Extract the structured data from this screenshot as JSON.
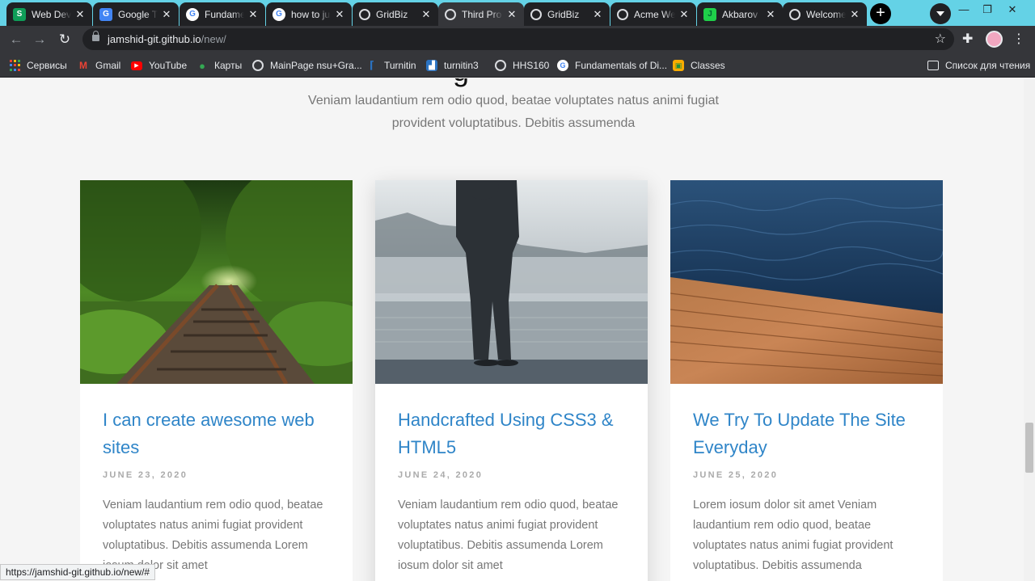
{
  "tabs": [
    {
      "title": "Web Dev",
      "favicon": "sheets-icon"
    },
    {
      "title": "Google Tr",
      "favicon": "translate-icon"
    },
    {
      "title": "Fundame",
      "favicon": "google-icon"
    },
    {
      "title": "how to ju",
      "favicon": "google-icon"
    },
    {
      "title": "GridBiz",
      "favicon": "globe-icon"
    },
    {
      "title": "Third Pro",
      "favicon": "globe-icon"
    },
    {
      "title": "GridBiz",
      "favicon": "globe-icon"
    },
    {
      "title": "Acme We",
      "favicon": "globe-icon"
    },
    {
      "title": "Akbarov",
      "favicon": "j-icon"
    },
    {
      "title": "Welcome",
      "favicon": "globe-icon"
    }
  ],
  "address": {
    "host": "jamshid-git.github.io",
    "path": "/new/"
  },
  "bookmarks": [
    {
      "label": "Сервисы"
    },
    {
      "label": "Gmail"
    },
    {
      "label": "YouTube"
    },
    {
      "label": "Карты"
    },
    {
      "label": "MainPage nsu+Gra..."
    },
    {
      "label": "Turnitin"
    },
    {
      "label": "turnitin3"
    },
    {
      "label": "HHS160"
    },
    {
      "label": "Fundamentals of Di..."
    },
    {
      "label": "Classes"
    }
  ],
  "reading_list": "Список для чтения",
  "page": {
    "heading_fragment": "g",
    "intro": "Veniam laudantium rem odio quod, beatae voluptates natus animi fugiat provident voluptatibus. Debitis assumenda"
  },
  "cards": [
    {
      "image": "railway-forest-photo",
      "title": "I can create awesome web sites",
      "date": "JUNE 23, 2020",
      "body": "Veniam laudantium rem odio quod, beatae voluptates natus animi fugiat provident voluptatibus. Debitis assumenda Lorem iosum dolor sit amet"
    },
    {
      "image": "man-by-misty-lake-photo",
      "title": "Handcrafted Using CSS3 & HTML5",
      "date": "JUNE 24, 2020",
      "body": "Veniam laudantium rem odio quod, beatae voluptates natus animi fugiat provident voluptatibus. Debitis assumenda Lorem iosum dolor sit amet"
    },
    {
      "image": "wooden-pier-sea-photo",
      "title": "We Try To Update The Site Everyday",
      "date": "JUNE 25, 2020",
      "body": "Lorem iosum dolor sit amet Veniam laudantium rem odio quod, beatae voluptates natus animi fugiat provident voluptatibus. Debitis assumenda"
    }
  ],
  "status_url": "https://jamshid-git.github.io/new/#",
  "colors": {
    "accent": "#2f85c8",
    "tabstrip": "#64d2e6",
    "chrome": "#35363a"
  }
}
